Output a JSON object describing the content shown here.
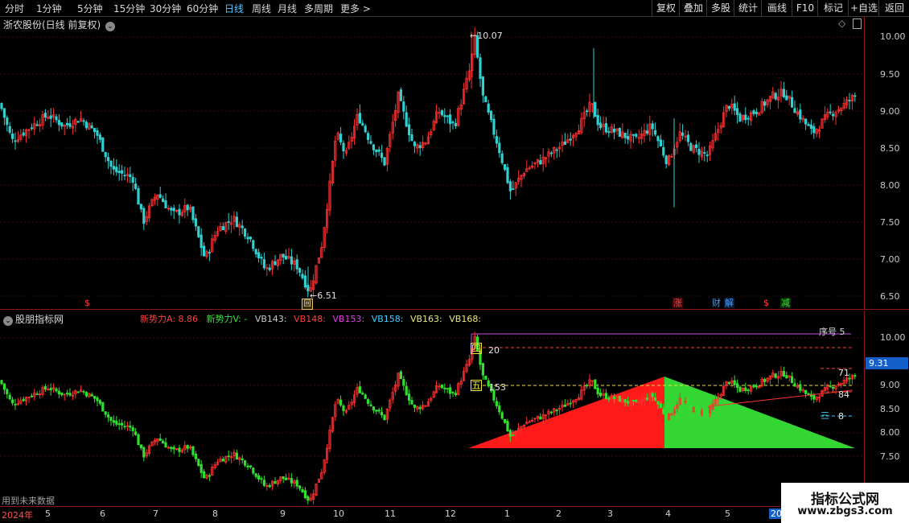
{
  "toolbar": {
    "periods": [
      "分时",
      "1分钟",
      "5分钟",
      "15分钟",
      "30分钟",
      "60分钟",
      "日线",
      "周线",
      "月线",
      "多周期",
      "更多 >"
    ],
    "active_period": "日线",
    "right_buttons": [
      "复权",
      "叠加",
      "多股",
      "统计",
      "画线",
      "F10",
      "标记",
      "+自选",
      "返回"
    ]
  },
  "main_panel": {
    "title": "浙农股份(日线 前复权)",
    "high_label": "10.07",
    "low_label": "6.51",
    "low_marker": "回",
    "price_axis": [
      "10.00",
      "9.50",
      "9.00",
      "8.50",
      "8.00",
      "7.50",
      "7.00",
      "6.50"
    ],
    "event_markers": [
      {
        "text": "$",
        "color": "#ff4040"
      },
      {
        "text": "涨",
        "color": "#ff4040"
      },
      {
        "text": "财",
        "color": "#40a0ff"
      },
      {
        "text": "解",
        "color": "#40a0ff"
      },
      {
        "text": "$",
        "color": "#ff4040"
      },
      {
        "text": "减",
        "color": "#40e040"
      }
    ]
  },
  "indicator_panel": {
    "title": "股朋指标网",
    "legend": [
      {
        "text": "新势力A: 8.86",
        "color": "#ff4040"
      },
      {
        "text": "新势力V: -",
        "color": "#40e040"
      },
      {
        "text": "VB143:",
        "color": "#c8c8c8"
      },
      {
        "text": "VB148:",
        "color": "#ff4040"
      },
      {
        "text": "VB153:",
        "color": "#e040e0"
      },
      {
        "text": "VB158:",
        "color": "#40d0ff"
      },
      {
        "text": "VB163:",
        "color": "#e8e880"
      },
      {
        "text": "VB168:",
        "color": "#e8e880"
      }
    ],
    "price_axis": [
      "10.00",
      "9.00",
      "8.50",
      "8.00",
      "7.50"
    ],
    "current_price": "9.31",
    "labels": {
      "seq": "序号",
      "seq_val": "5",
      "four": "四",
      "four_val": "20",
      "five": "五",
      "five_val": "153",
      "r1": "71",
      "r2": "84",
      "r3": "8",
      "r3_prefix": "三"
    },
    "footer_note": "用到未来数据"
  },
  "time_axis": {
    "year": "2024年",
    "months": [
      "5",
      "6",
      "7",
      "8",
      "9",
      "10",
      "11",
      "12",
      "1",
      "2",
      "3",
      "4",
      "5",
      "20"
    ]
  },
  "watermark": {
    "title": "指标公式网",
    "url": "www.zbgs3.com"
  },
  "colors": {
    "up": "#ff3030",
    "down": "#30d0d0",
    "ind_up": "#ff3030",
    "ind_down": "#30e030",
    "red_triangle": "#ff1a1a",
    "green_triangle": "#33d633"
  }
}
